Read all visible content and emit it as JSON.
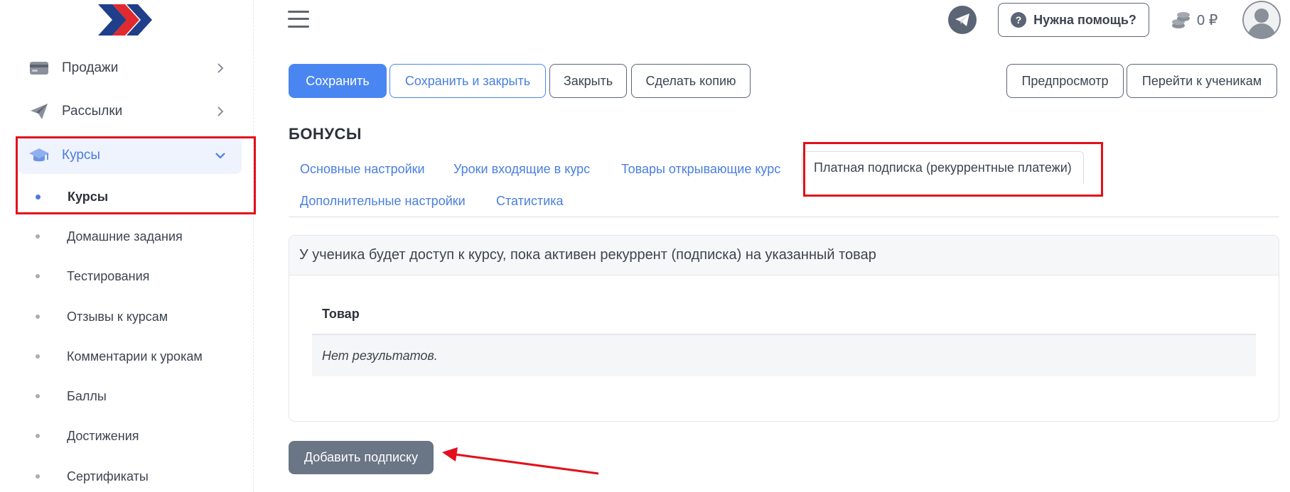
{
  "sidebar": {
    "items": [
      {
        "label": "Продажи",
        "icon": "wallet-icon"
      },
      {
        "label": "Рассылки",
        "icon": "paper-plane-icon"
      },
      {
        "label": "Курсы",
        "icon": "graduation-cap-icon"
      }
    ],
    "subitems": [
      {
        "label": "Курсы"
      },
      {
        "label": "Домашние задания"
      },
      {
        "label": "Тестирования"
      },
      {
        "label": "Отзывы к курсам"
      },
      {
        "label": "Комментарии к урокам"
      },
      {
        "label": "Баллы"
      },
      {
        "label": "Достижения"
      },
      {
        "label": "Сертификаты"
      }
    ]
  },
  "header": {
    "help_label": "Нужна помощь?",
    "help_icon": "?",
    "balance": "0 ₽"
  },
  "toolbar": {
    "save": "Сохранить",
    "save_close": "Сохранить и закрыть",
    "close": "Закрыть",
    "copy": "Сделать копию",
    "preview": "Предпросмотр",
    "students": "Перейти к ученикам"
  },
  "page": {
    "title": "БОНУСЫ"
  },
  "tabs": [
    {
      "label": "Основные настройки"
    },
    {
      "label": "Уроки входящие в курс"
    },
    {
      "label": "Товары открывающие курс"
    },
    {
      "label": "Платная подписка (рекуррентные платежи)"
    },
    {
      "label": "Дополнительные настройки"
    },
    {
      "label": "Статистика"
    }
  ],
  "panel": {
    "header": "У ученика будет доступ к курсу, пока активен рекуррент (подписка) на указанный товар",
    "table": {
      "column": "Товар",
      "empty": "Нет результатов."
    }
  },
  "add_button": "Добавить подписку",
  "colors": {
    "primary": "#4a86f2",
    "annotation": "#e3101b",
    "secondary": "#6a7585"
  }
}
